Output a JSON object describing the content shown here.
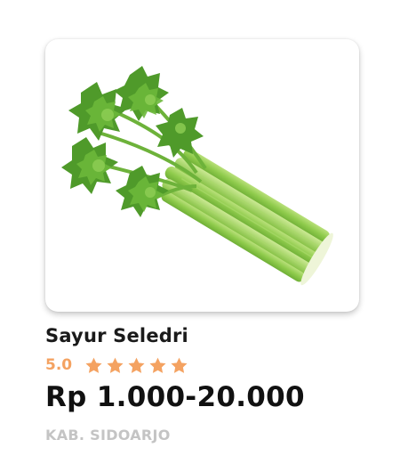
{
  "product": {
    "image_icon": "celery-image",
    "name": "Sayur Seledri",
    "rating": "5.0",
    "stars_filled": 5,
    "stars_total": 5,
    "price": "Rp 1.000-20.000",
    "location": "KAB. SIDOARJO"
  },
  "colors": {
    "star": "#f4a261",
    "rating_text": "#f4a261",
    "title_text": "#1a1a1a",
    "location_text": "#c4c4c4"
  }
}
